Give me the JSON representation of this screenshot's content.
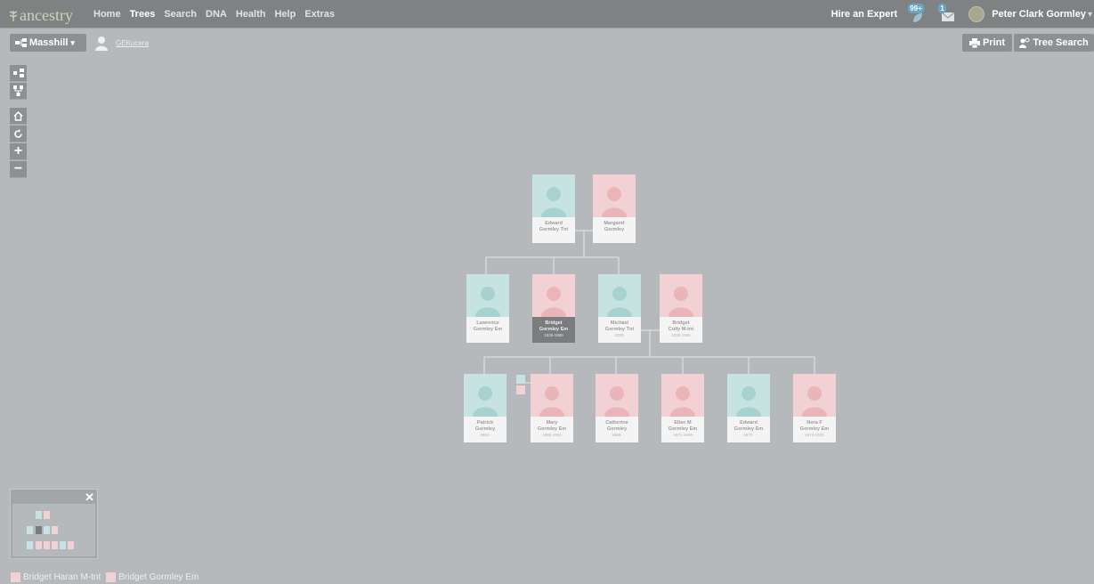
{
  "nav": {
    "logo": "ancestry",
    "items": [
      "Home",
      "Trees",
      "Search",
      "DNA",
      "Health",
      "Help",
      "Extras"
    ],
    "active": "Trees",
    "hire": "Hire an Expert",
    "hints_badge": "99+",
    "messages_badge": "1",
    "user": "Peter Clark Gormley"
  },
  "toolbar": {
    "tree_name": "Masshill",
    "owner": "GEKucera",
    "print": "Print",
    "tree_search": "Tree Search"
  },
  "tree": {
    "gen1": [
      {
        "name1": "Edward",
        "name2": "Gormley Tnt",
        "dates": "",
        "sex": "male"
      },
      {
        "name1": "Margaret",
        "name2": "Gormley",
        "dates": "",
        "sex": "female"
      }
    ],
    "gen2": [
      {
        "name1": "Lawrence",
        "name2": "Gormley Em",
        "dates": "",
        "sex": "male"
      },
      {
        "name1": "Bridget",
        "name2": "Gormley Em",
        "dates": "1829-1889",
        "sex": "female",
        "selected": true
      },
      {
        "name1": "Michael",
        "name2": "Gormley Tnt",
        "dates": "1830-",
        "sex": "male"
      },
      {
        "name1": "Bridget",
        "name2": "Cully M-tnt",
        "dates": "1835-1896",
        "sex": "female"
      }
    ],
    "gen3": [
      {
        "name1": "Patrick",
        "name2": "Gormley",
        "dates": "1862-",
        "sex": "male"
      },
      {
        "name1": "Mary",
        "name2": "Gormley Em",
        "dates": "1865-1924",
        "sex": "female"
      },
      {
        "name1": "Catherine",
        "name2": "Gormley",
        "dates": "1869-",
        "sex": "female"
      },
      {
        "name1": "Ellen M",
        "name2": "Gormley Em",
        "dates": "1871-1959",
        "sex": "female"
      },
      {
        "name1": "Edward",
        "name2": "Gormley Em",
        "dates": "1872-",
        "sex": "male"
      },
      {
        "name1": "Nora F",
        "name2": "Gormley Em",
        "dates": "1873-1921",
        "sex": "female"
      }
    ]
  },
  "recent": [
    "Bridget Haran M-tnt",
    "Bridget Gormley Em"
  ],
  "colors": {
    "male": "#c6e2e1",
    "female": "#f1d1d3",
    "nav": "#7f8183",
    "bg": "#b6b9bc"
  }
}
